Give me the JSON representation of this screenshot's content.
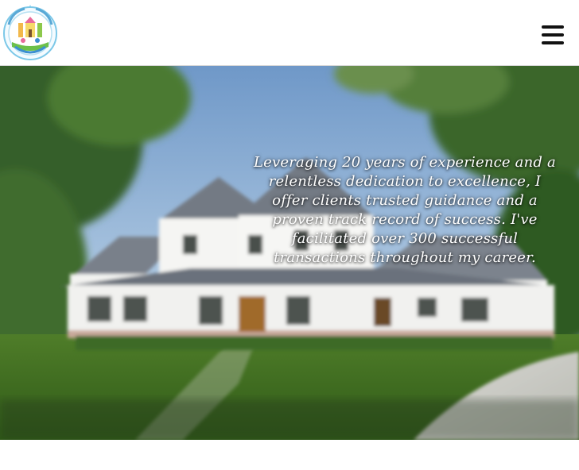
{
  "header": {
    "logo_icon": "agency-badge-logo",
    "menu_icon": "hamburger-menu-icon"
  },
  "hero": {
    "image_icon": "farmhouse-photo",
    "tagline": "Leveraging 20 years of experience and a relentless dedication to excellence, I offer clients trusted guidance and a proven track record of success. I've facilitated over 300 successful transactions throughout my career."
  },
  "colors": {
    "header_bg": "#ffffff",
    "menu_icon": "#111111",
    "hero_text": "#ffffff"
  }
}
